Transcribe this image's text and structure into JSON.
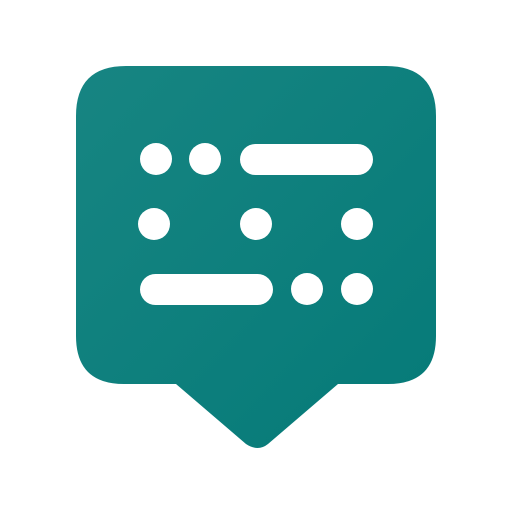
{
  "icon": {
    "name": "chat-bubble-morse-icon",
    "colors": {
      "gradient_start": "#178582",
      "gradient_end": "#057A78",
      "glyph": "#ffffff",
      "background": "#ffffff"
    },
    "rows": [
      [
        "dot",
        "dot",
        "dash"
      ],
      [
        "dot",
        "dot",
        "dot"
      ],
      [
        "dash",
        "dot",
        "dot"
      ]
    ]
  }
}
